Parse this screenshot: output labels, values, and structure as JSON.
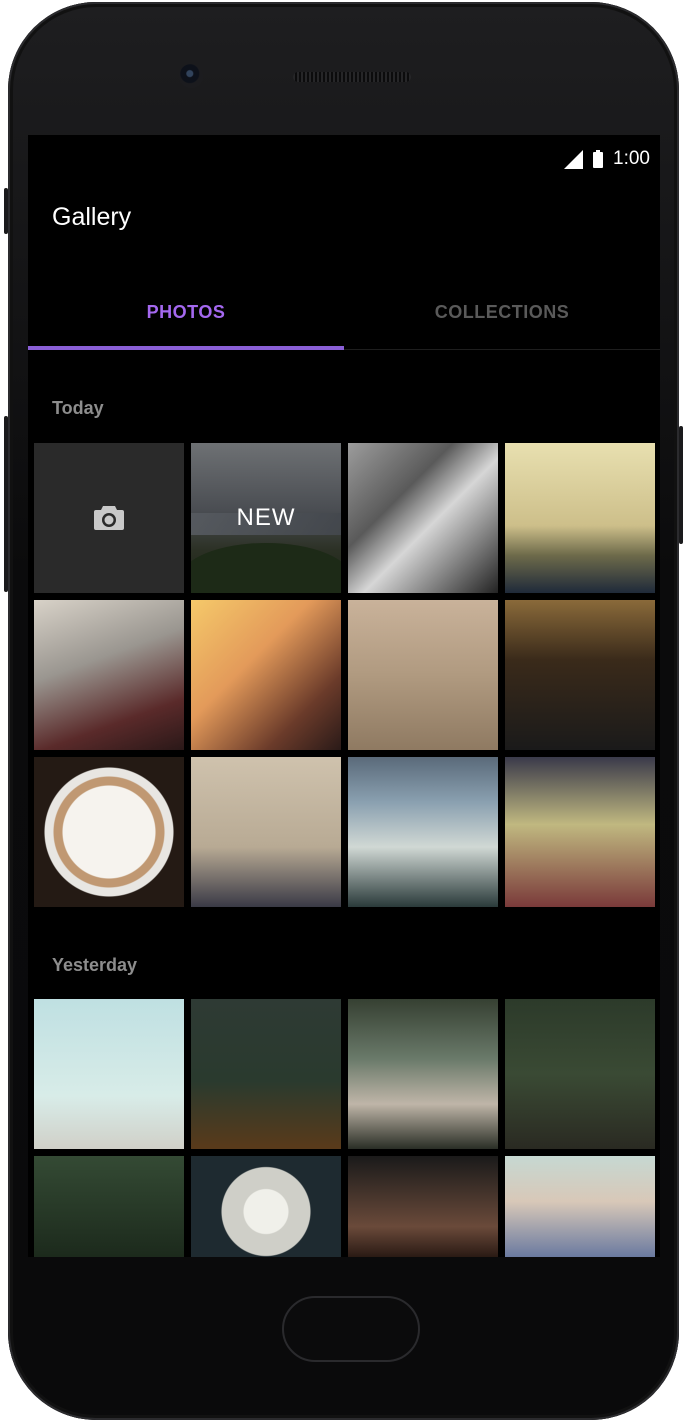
{
  "status_bar": {
    "time": "1:00"
  },
  "app": {
    "title": "Gallery"
  },
  "tabs": [
    {
      "label": "PHOTOS",
      "active": true
    },
    {
      "label": "COLLECTIONS",
      "active": false
    }
  ],
  "colors": {
    "accent": "#a468ef",
    "background": "#000000",
    "section_title": "#8d8d8d"
  },
  "sections": [
    {
      "title": "Today",
      "camera_tile": {
        "icon": "camera-icon"
      },
      "new_tile": {
        "label": "NEW"
      },
      "photo_count": 10
    },
    {
      "title": "Yesterday",
      "photo_count": 8
    }
  ]
}
